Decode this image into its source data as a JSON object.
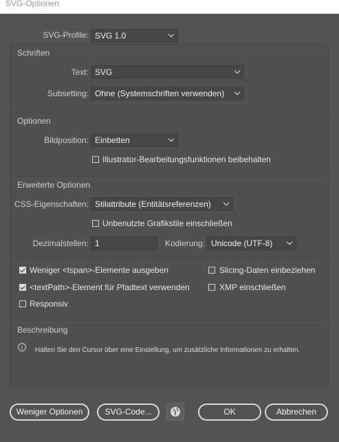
{
  "window": {
    "title": "SVG-Optionen"
  },
  "profile": {
    "label": "SVG-Profile:",
    "value": "SVG 1.0"
  },
  "fonts": {
    "title": "Schriften",
    "type_label": "Text:",
    "type_value": "SVG",
    "subsetting_label": "Subsetting:",
    "subsetting_value": "Ohne (Systemschriften verwenden)"
  },
  "options": {
    "title": "Optionen",
    "image_location_label": "Bildposition:",
    "image_location_value": "Einbetten",
    "preserve_label": "Illustrator-Bearbeitungsfunktionen beibehalten",
    "preserve_checked": false
  },
  "advanced": {
    "title": "Erweiterte Optionen",
    "css_label": "CSS-Eigenschaften:",
    "css_value": "Stilattribute (Entitätsreferenzen)",
    "unused_styles_label": "Unbenutzte Grafikstile einschließen",
    "unused_styles_checked": false,
    "decimal_label": "Dezimalstellen:",
    "decimal_value": "1",
    "encoding_label": "Kodierung:",
    "encoding_value": "Unicode (UTF-8)",
    "tspan_label": "Weniger <tspan>-Elemente ausgeben",
    "tspan_checked": true,
    "slicing_label": "Slicing-Daten einbeziehen",
    "slicing_checked": false,
    "textpath_label": "<textPath>-Element für Pfadtext verwenden",
    "textpath_checked": true,
    "xmp_label": "XMP einschließen",
    "xmp_checked": false,
    "responsive_label": "Responsiv",
    "responsive_checked": false
  },
  "description": {
    "title": "Beschreibung",
    "text": "Halten Sie den Cursor über eine Einstellung, um zusätzliche Informationen zu erhalten."
  },
  "buttons": {
    "fewer_options": "Weniger Optionen",
    "svg_code": "SVG-Code...",
    "ok": "OK",
    "cancel": "Abbrechen"
  }
}
